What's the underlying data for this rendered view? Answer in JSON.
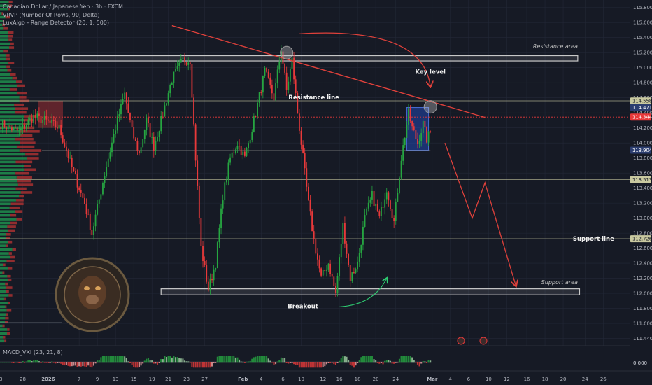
{
  "legend": {
    "title": "Canadian Dollar / Japanese Yen · 3h · FXCM",
    "indicator_1": "VRVP (Number Of Rows, 90, Delta)",
    "indicator_2": "LuxAlgo - Range Detector (20, 1, 500)"
  },
  "macd_label": "MACD_VXI (23, 21, 8)",
  "macd_value": "0.000",
  "colors": {
    "background": "#161a25",
    "up": "#26a641",
    "down": "#e8393a",
    "zone_stroke": "#c8c8c8",
    "trend": "#e0413b",
    "level": "#c9c9a0",
    "green_arrow": "#2ecc71",
    "price_tag_red": "#e8393a",
    "price_tag_blue": "#2c3e70",
    "price_tag_level": "#c9c9a0"
  },
  "chart_data": {
    "type": "candlestick",
    "ylim": [
      111.34,
      115.9
    ],
    "y_ticks": [
      115.8,
      115.6,
      115.4,
      115.2,
      115.0,
      114.8,
      114.6,
      114.4,
      114.2,
      114.0,
      113.8,
      113.6,
      113.4,
      113.2,
      113.0,
      112.8,
      112.6,
      112.4,
      112.2,
      112.0,
      111.8,
      111.6,
      111.4
    ],
    "y_tick_labels": [
      "115.800",
      "115.600",
      "115.400",
      "115.200",
      "115.000",
      "114.800",
      "114.600",
      "114.400",
      "114.200",
      "114.000",
      "113.800",
      "113.600",
      "113.400",
      "113.200",
      "113.000",
      "112.800",
      "112.600",
      "112.400",
      "112.200",
      "112.000",
      "111.800",
      "111.600",
      "111.440"
    ],
    "x_ticks": [
      {
        "label": "3",
        "idx": 0
      },
      {
        "label": "28",
        "idx": 12
      },
      {
        "label": "2026",
        "idx": 26
      },
      {
        "label": "7",
        "idx": 43
      },
      {
        "label": "9",
        "idx": 53
      },
      {
        "label": "13",
        "idx": 63
      },
      {
        "label": "15",
        "idx": 73
      },
      {
        "label": "19",
        "idx": 83
      },
      {
        "label": "21",
        "idx": 92
      },
      {
        "label": "23",
        "idx": 102
      },
      {
        "label": "27",
        "idx": 112
      },
      {
        "label": "Feb",
        "idx": 133
      },
      {
        "label": "4",
        "idx": 143
      },
      {
        "label": "6",
        "idx": 155
      },
      {
        "label": "10",
        "idx": 165
      },
      {
        "label": "12",
        "idx": 177
      },
      {
        "label": "16",
        "idx": 186
      },
      {
        "label": "18",
        "idx": 196
      },
      {
        "label": "20",
        "idx": 206
      },
      {
        "label": "24",
        "idx": 217
      },
      {
        "label": "Mar",
        "idx": 237
      },
      {
        "label": "4",
        "idx": 247
      },
      {
        "label": "6",
        "idx": 257
      },
      {
        "label": "10",
        "idx": 268
      },
      {
        "label": "12",
        "idx": 278
      },
      {
        "label": "16",
        "idx": 289
      },
      {
        "label": "18",
        "idx": 299
      },
      {
        "label": "20",
        "idx": 309
      },
      {
        "label": "24",
        "idx": 321
      },
      {
        "label": "26",
        "idx": 331
      }
    ],
    "x_span": 346,
    "anchors": [
      [
        0,
        114.25
      ],
      [
        10,
        114.15
      ],
      [
        18,
        114.35
      ],
      [
        24,
        114.3
      ],
      [
        32,
        114.2
      ],
      [
        40,
        113.6
      ],
      [
        46,
        113.2
      ],
      [
        50,
        112.8
      ],
      [
        54,
        113.25
      ],
      [
        58,
        113.7
      ],
      [
        64,
        114.3
      ],
      [
        68,
        114.65
      ],
      [
        72,
        114.15
      ],
      [
        76,
        113.85
      ],
      [
        80,
        114.3
      ],
      [
        84,
        113.95
      ],
      [
        88,
        114.3
      ],
      [
        94,
        114.85
      ],
      [
        100,
        115.1
      ],
      [
        104,
        115.1
      ],
      [
        107,
        113.8
      ],
      [
        110,
        112.6
      ],
      [
        114,
        112.05
      ],
      [
        118,
        112.4
      ],
      [
        122,
        113.3
      ],
      [
        126,
        113.8
      ],
      [
        130,
        114.0
      ],
      [
        134,
        113.8
      ],
      [
        140,
        114.4
      ],
      [
        145,
        114.95
      ],
      [
        150,
        114.6
      ],
      [
        154,
        115.25
      ],
      [
        157,
        114.7
      ],
      [
        160,
        115.1
      ],
      [
        163,
        114.4
      ],
      [
        166,
        113.8
      ],
      [
        169,
        113.2
      ],
      [
        172,
        112.7
      ],
      [
        176,
        112.2
      ],
      [
        180,
        112.4
      ],
      [
        184,
        112.0
      ],
      [
        188,
        112.9
      ],
      [
        192,
        112.2
      ],
      [
        196,
        112.4
      ],
      [
        200,
        113.0
      ],
      [
        204,
        113.3
      ],
      [
        208,
        113.0
      ],
      [
        212,
        113.4
      ],
      [
        216,
        112.95
      ],
      [
        220,
        113.8
      ],
      [
        224,
        114.4
      ],
      [
        226,
        114.2
      ],
      [
        229,
        114.0
      ],
      [
        232,
        114.25
      ],
      [
        234,
        114.05
      ],
      [
        236,
        114.15
      ]
    ],
    "series": [
      {
        "name": "Resistance area",
        "type": "zone",
        "y": [
          115.09,
          115.16
        ],
        "x": [
          34,
          317
        ]
      },
      {
        "name": "Support area",
        "type": "zone",
        "y": [
          111.98,
          112.06
        ],
        "x": [
          88,
          318
        ]
      },
      {
        "name": "Resistance line",
        "type": "hline",
        "y": 114.56
      },
      {
        "name": "Support line",
        "type": "hline",
        "y": 112.726
      },
      {
        "name": "range_level",
        "type": "hline",
        "y": 113.513
      },
      {
        "name": "range_box",
        "type": "rect",
        "y": [
          113.904,
          114.471
        ],
        "x": [
          223,
          235
        ]
      }
    ],
    "annotations": [
      {
        "text": "Resistance area",
        "italic": true
      },
      {
        "text": "Key level"
      },
      {
        "text": "Resistance line"
      },
      {
        "text": "Support line"
      },
      {
        "text": "Support area",
        "italic": true
      },
      {
        "text": "Breakout"
      }
    ],
    "trendline": [
      [
        94,
        115.56
      ],
      [
        266,
        114.34
      ]
    ],
    "projection": [
      [
        244,
        114.0
      ],
      [
        259,
        113.0
      ],
      [
        266,
        113.47
      ],
      [
        283,
        112.1
      ]
    ],
    "price_tags": [
      {
        "label": "114.558",
        "y": 114.558,
        "kind": "level"
      },
      {
        "label": "114.471",
        "y": 114.471,
        "kind": "blue"
      },
      {
        "label": "114.344",
        "y": 114.344,
        "kind": "red"
      },
      {
        "label": "113.904",
        "y": 113.904,
        "kind": "blue"
      },
      {
        "label": "113.513",
        "y": 113.513,
        "kind": "level"
      },
      {
        "label": "112.726",
        "y": 112.726,
        "kind": "level"
      }
    ]
  }
}
